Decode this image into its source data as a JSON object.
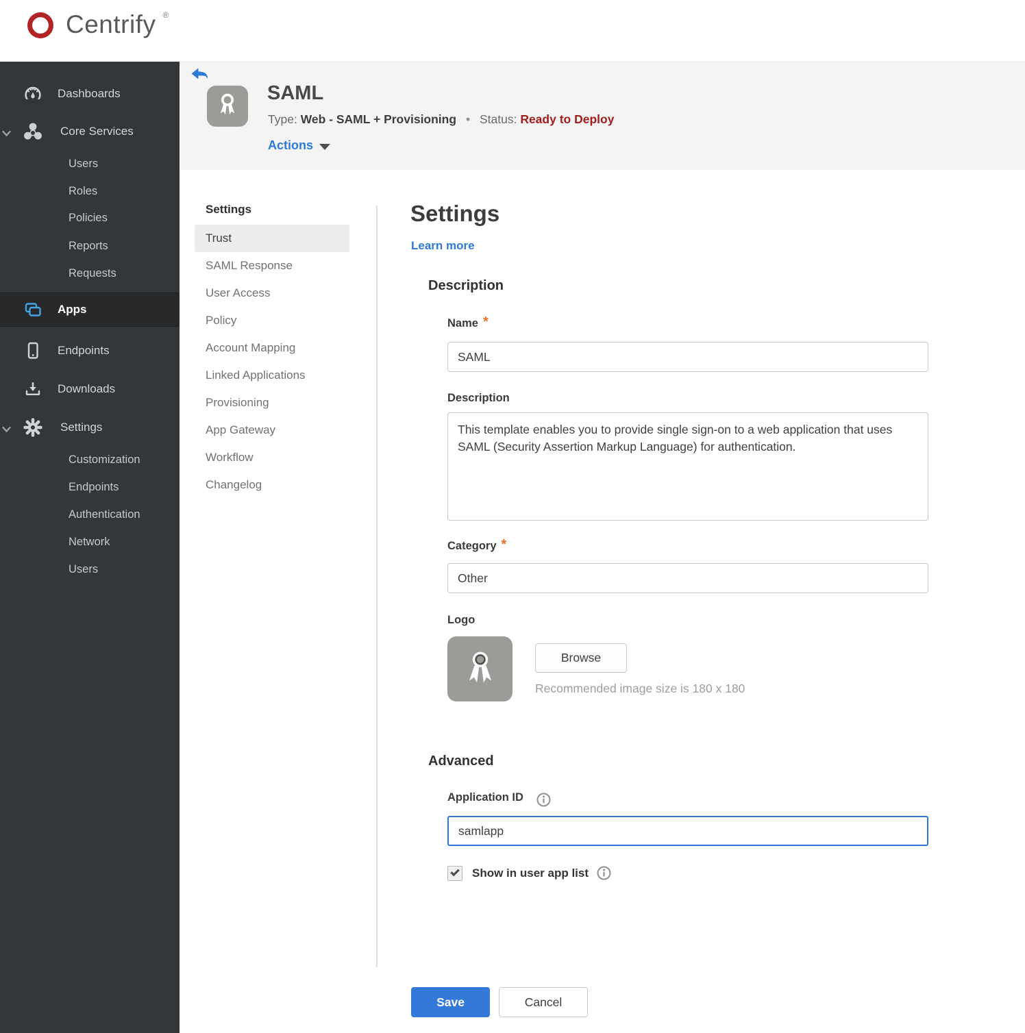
{
  "brand": {
    "name": "Centrify",
    "trademark": "®"
  },
  "colors": {
    "brand_red": "#b22527",
    "accent_blue": "#2e7ad8",
    "save_blue": "#3379da",
    "status_red": "#a31d1d",
    "required_orange": "#ed7024",
    "sidebar_bg": "#343739",
    "sidebar_active_bg": "#27292b",
    "apps_icon_blue": "#41a4e0",
    "header_bg": "#f4f4f5"
  },
  "sidebar": {
    "items": [
      {
        "label": "Dashboards"
      },
      {
        "label": "Core Services"
      },
      {
        "label": "Users"
      },
      {
        "label": "Roles"
      },
      {
        "label": "Policies"
      },
      {
        "label": "Reports"
      },
      {
        "label": "Requests"
      },
      {
        "label": "Apps"
      },
      {
        "label": "Endpoints"
      },
      {
        "label": "Downloads"
      },
      {
        "label": "Settings"
      },
      {
        "label": "Customization"
      },
      {
        "label": "Endpoints"
      },
      {
        "label": "Authentication"
      },
      {
        "label": "Network"
      },
      {
        "label": "Users"
      }
    ],
    "active_item": "Apps"
  },
  "header": {
    "app_title": "SAML",
    "type_label": "Type:",
    "type_value": "Web - SAML + Provisioning",
    "separator": "•",
    "status_label": "Status:",
    "status_value": "Ready to Deploy",
    "actions_label": "Actions"
  },
  "subnav": {
    "header": "Settings",
    "active_item": "Trust",
    "items": [
      {
        "label": "Trust"
      },
      {
        "label": "SAML Response"
      },
      {
        "label": "User Access"
      },
      {
        "label": "Policy"
      },
      {
        "label": "Account Mapping"
      },
      {
        "label": "Linked Applications"
      },
      {
        "label": "Provisioning"
      },
      {
        "label": "App Gateway"
      },
      {
        "label": "Workflow"
      },
      {
        "label": "Changelog"
      }
    ]
  },
  "main": {
    "title": "Settings",
    "learn_more_label": "Learn more",
    "description_section": {
      "heading": "Description",
      "name": {
        "label": "Name",
        "required_marker": "*",
        "value": "SAML"
      },
      "description": {
        "label": "Description",
        "value": "This template enables you to provide single sign-on to a web application that uses SAML (Security Assertion Markup Language) for authentication."
      },
      "category": {
        "label": "Category",
        "required_marker": "*",
        "value": "Other"
      },
      "logo": {
        "label": "Logo",
        "browse_button_label": "Browse",
        "hint": "Recommended image size is 180 x 180"
      }
    },
    "advanced_section": {
      "heading": "Advanced",
      "application_id": {
        "label": "Application ID",
        "value": "samlapp"
      },
      "show_in_user_app_list": {
        "label": "Show in user app list",
        "checked": true
      }
    },
    "footer": {
      "save_label": "Save",
      "cancel_label": "Cancel"
    }
  }
}
